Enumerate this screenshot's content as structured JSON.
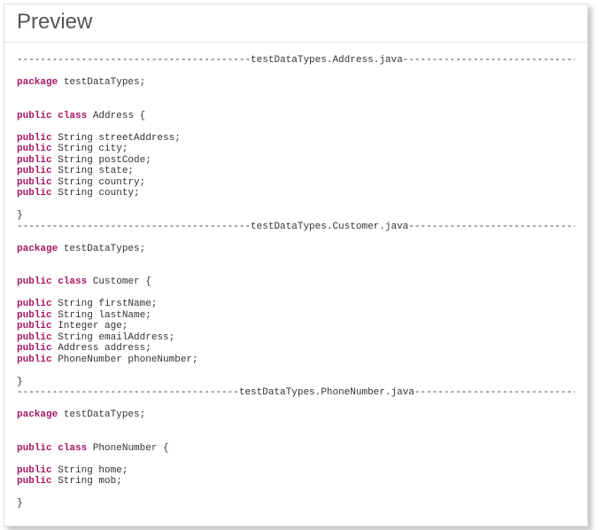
{
  "header": {
    "title": "Preview"
  },
  "code": {
    "files": [
      {
        "divider_label": "testDataTypes.Address.java",
        "package": "testDataTypes",
        "class_name": "Address",
        "fields": [
          {
            "type": "String",
            "name": "streetAddress"
          },
          {
            "type": "String",
            "name": "city"
          },
          {
            "type": "String",
            "name": "postCode"
          },
          {
            "type": "String",
            "name": "state"
          },
          {
            "type": "String",
            "name": "country"
          },
          {
            "type": "String",
            "name": "county"
          }
        ]
      },
      {
        "divider_label": "testDataTypes.Customer.java",
        "package": "testDataTypes",
        "class_name": "Customer",
        "fields": [
          {
            "type": "String",
            "name": "firstName"
          },
          {
            "type": "String",
            "name": "lastName"
          },
          {
            "type": "Integer",
            "name": "age"
          },
          {
            "type": "String",
            "name": "emailAddress"
          },
          {
            "type": "Address",
            "name": "address"
          },
          {
            "type": "PhoneNumber",
            "name": "phoneNumber"
          }
        ]
      },
      {
        "divider_label": "testDataTypes.PhoneNumber.java",
        "package": "testDataTypes",
        "class_name": "PhoneNumber",
        "fields": [
          {
            "type": "String",
            "name": "home"
          },
          {
            "type": "String",
            "name": "mob"
          }
        ]
      }
    ],
    "keywords": {
      "package": "package",
      "public": "public",
      "class": "class"
    }
  }
}
